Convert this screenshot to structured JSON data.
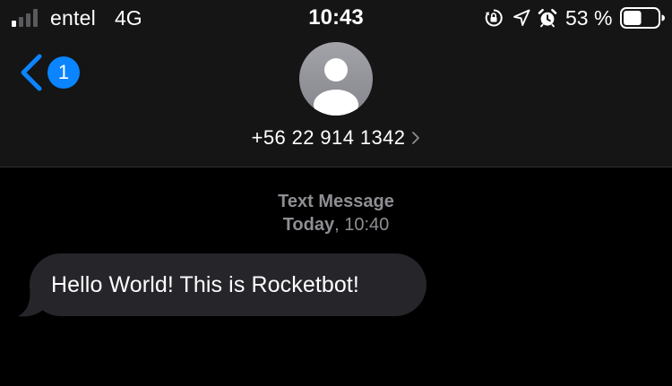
{
  "status_bar": {
    "carrier": "entel",
    "network": "4G",
    "time": "10:43",
    "battery_percent": "53 %",
    "battery_level": 0.53,
    "signal_bars_filled": 1,
    "signal_bars_total": 4,
    "icons": [
      "orientation-lock-icon",
      "location-arrow-icon",
      "alarm-icon"
    ]
  },
  "nav": {
    "unread_count": "1",
    "contact": "+56 22 914 1342"
  },
  "conversation": {
    "service": "Text Message",
    "day": "Today",
    "time": ", 10:40",
    "messages": [
      {
        "direction": "incoming",
        "text": "Hello World! This is Rocketbot!"
      }
    ]
  },
  "colors": {
    "background": "#000000",
    "header": "#151515",
    "accent": "#0a84ff",
    "bubble_incoming": "#26252a",
    "meta_text": "#8e8e93"
  }
}
